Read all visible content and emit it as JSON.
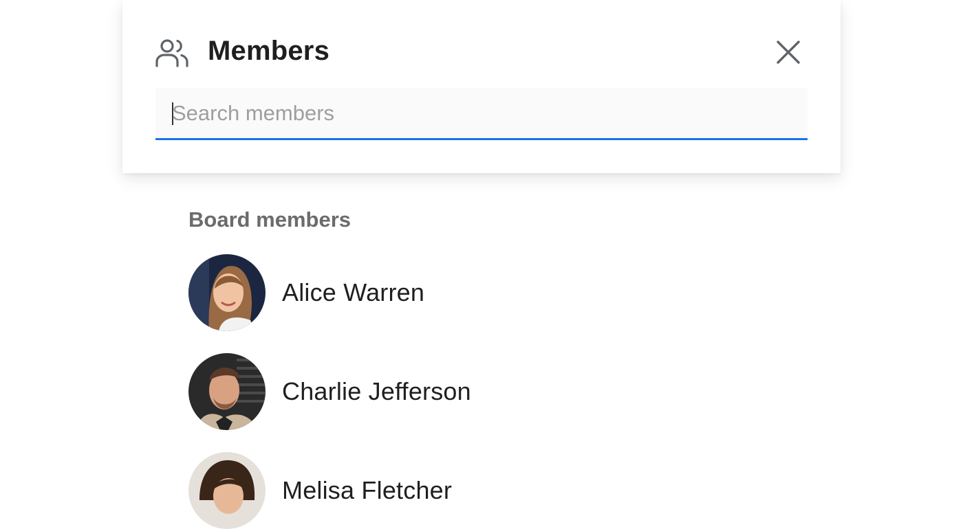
{
  "panel": {
    "title": "Members",
    "icon": "members-icon",
    "close_icon": "close-icon"
  },
  "search": {
    "placeholder": "Search members",
    "value": "",
    "accent_color": "#1a73e8"
  },
  "board_members": {
    "label": "Board members",
    "members": [
      {
        "name": "Alice Warren",
        "avatar": "avatar-alice-warren"
      },
      {
        "name": "Charlie Jefferson",
        "avatar": "avatar-charlie-jefferson"
      },
      {
        "name": "Melisa Fletcher",
        "avatar": "avatar-melisa-fletcher"
      }
    ]
  }
}
